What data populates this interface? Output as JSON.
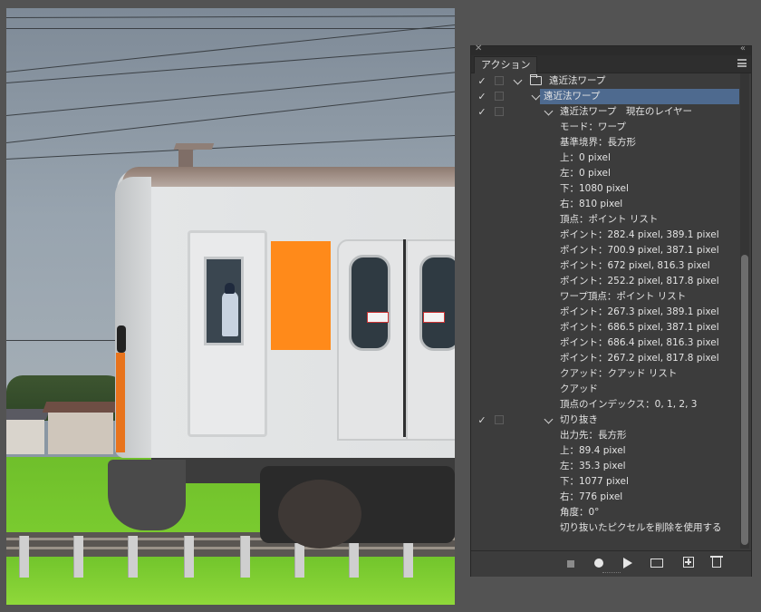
{
  "panel": {
    "tab_label": "アクション",
    "rows": [
      {
        "level": 0,
        "checked": true,
        "expander": true,
        "folder": true,
        "text": "遠近法ワープ",
        "selected": false
      },
      {
        "level": 1,
        "checked": true,
        "expander": true,
        "folder": false,
        "text": "遠近法ワープ",
        "selected": true
      },
      {
        "level": 2,
        "checked": true,
        "expander": true,
        "folder": false,
        "text": "遠近法ワープ　現在のレイヤー",
        "selected": false
      },
      {
        "level": 3,
        "checked": false,
        "expander": false,
        "folder": false,
        "text": "モード：ワープ",
        "selected": false
      },
      {
        "level": 3,
        "checked": false,
        "expander": false,
        "folder": false,
        "text": "基準境界：長方形",
        "selected": false
      },
      {
        "level": 3,
        "checked": false,
        "expander": false,
        "folder": false,
        "text": "上：0 pixel",
        "selected": false
      },
      {
        "level": 3,
        "checked": false,
        "expander": false,
        "folder": false,
        "text": "左：0 pixel",
        "selected": false
      },
      {
        "level": 3,
        "checked": false,
        "expander": false,
        "folder": false,
        "text": "下：1080 pixel",
        "selected": false
      },
      {
        "level": 3,
        "checked": false,
        "expander": false,
        "folder": false,
        "text": "右：810 pixel",
        "selected": false
      },
      {
        "level": 3,
        "checked": false,
        "expander": false,
        "folder": false,
        "text": "頂点：ポイント リスト",
        "selected": false
      },
      {
        "level": 3,
        "checked": false,
        "expander": false,
        "folder": false,
        "text": "ポイント：282.4 pixel, 389.1 pixel",
        "selected": false
      },
      {
        "level": 3,
        "checked": false,
        "expander": false,
        "folder": false,
        "text": "ポイント：700.9 pixel, 387.1 pixel",
        "selected": false
      },
      {
        "level": 3,
        "checked": false,
        "expander": false,
        "folder": false,
        "text": "ポイント：672 pixel, 816.3 pixel",
        "selected": false
      },
      {
        "level": 3,
        "checked": false,
        "expander": false,
        "folder": false,
        "text": "ポイント：252.2 pixel, 817.8 pixel",
        "selected": false
      },
      {
        "level": 3,
        "checked": false,
        "expander": false,
        "folder": false,
        "text": "ワープ頂点：ポイント リスト",
        "selected": false
      },
      {
        "level": 3,
        "checked": false,
        "expander": false,
        "folder": false,
        "text": "ポイント：267.3 pixel, 389.1 pixel",
        "selected": false
      },
      {
        "level": 3,
        "checked": false,
        "expander": false,
        "folder": false,
        "text": "ポイント：686.5 pixel, 387.1 pixel",
        "selected": false
      },
      {
        "level": 3,
        "checked": false,
        "expander": false,
        "folder": false,
        "text": "ポイント：686.4 pixel, 816.3 pixel",
        "selected": false
      },
      {
        "level": 3,
        "checked": false,
        "expander": false,
        "folder": false,
        "text": "ポイント：267.2 pixel, 817.8 pixel",
        "selected": false
      },
      {
        "level": 3,
        "checked": false,
        "expander": false,
        "folder": false,
        "text": "クアッド：クアッド リスト",
        "selected": false
      },
      {
        "level": 3,
        "checked": false,
        "expander": false,
        "folder": false,
        "text": "クアッド",
        "selected": false
      },
      {
        "level": 3,
        "checked": false,
        "expander": false,
        "folder": false,
        "text": "頂点のインデックス：0, 1, 2, 3",
        "selected": false
      },
      {
        "level": 2,
        "checked": true,
        "expander": true,
        "folder": false,
        "text": "切り抜き",
        "selected": false
      },
      {
        "level": 3,
        "checked": false,
        "expander": false,
        "folder": false,
        "text": "出力先：長方形",
        "selected": false
      },
      {
        "level": 3,
        "checked": false,
        "expander": false,
        "folder": false,
        "text": "上：89.4 pixel",
        "selected": false
      },
      {
        "level": 3,
        "checked": false,
        "expander": false,
        "folder": false,
        "text": "左：35.3 pixel",
        "selected": false
      },
      {
        "level": 3,
        "checked": false,
        "expander": false,
        "folder": false,
        "text": "下：1077 pixel",
        "selected": false
      },
      {
        "level": 3,
        "checked": false,
        "expander": false,
        "folder": false,
        "text": "右：776 pixel",
        "selected": false
      },
      {
        "level": 3,
        "checked": false,
        "expander": false,
        "folder": false,
        "text": "角度：0°",
        "selected": false
      },
      {
        "level": 3,
        "checked": false,
        "expander": false,
        "folder": false,
        "text": "切り抜いたピクセルを削除を使用する",
        "selected": false
      }
    ],
    "bottom_buttons": [
      "stop-icon",
      "record-icon",
      "play-icon",
      "folder-icon",
      "new-action-icon",
      "trash-icon"
    ]
  },
  "colors": {
    "app_background": "#535353",
    "panel_background": "#3c3c3c",
    "selection": "#4e6a8f",
    "train_accent": "#ff8a1a"
  }
}
